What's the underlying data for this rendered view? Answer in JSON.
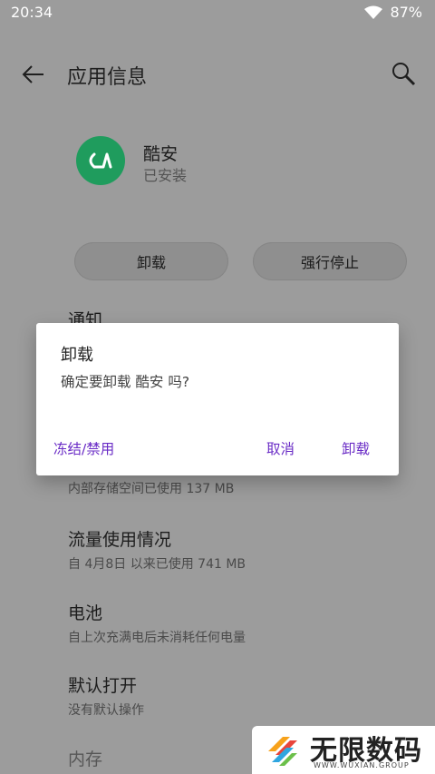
{
  "status": {
    "time": "20:34",
    "battery": "87%"
  },
  "toolbar": {
    "title": "应用信息"
  },
  "app": {
    "name": "酷安",
    "state": "已安装"
  },
  "actions": {
    "uninstall": "卸载",
    "force_stop": "强行停止"
  },
  "sections": {
    "notifications": {
      "title": "通知"
    },
    "storage": {
      "subtitle": "内部存储空间已使用 137 MB"
    },
    "data_usage": {
      "title": "流量使用情况",
      "subtitle": "自 4月8日 以来已使用 741 MB"
    },
    "battery": {
      "title": "电池",
      "subtitle": "自上次充满电后未消耗任何电量"
    },
    "open_by_default": {
      "title": "默认打开",
      "subtitle": "没有默认操作"
    },
    "memory": {
      "title": "内存"
    }
  },
  "dialog": {
    "title": "卸载",
    "message": "确定要卸载 酷安 吗?",
    "freeze_label": "冻结/禁用",
    "cancel_label": "取消",
    "uninstall_label": "卸载"
  },
  "watermark": {
    "main": "无限数码",
    "sub": "WWW.WUXIAN.GROUP"
  },
  "colors": {
    "dim_background": "#9c9c9c",
    "dialog_accent": "#6a2cc6",
    "app_icon": "#1f9c5d"
  }
}
